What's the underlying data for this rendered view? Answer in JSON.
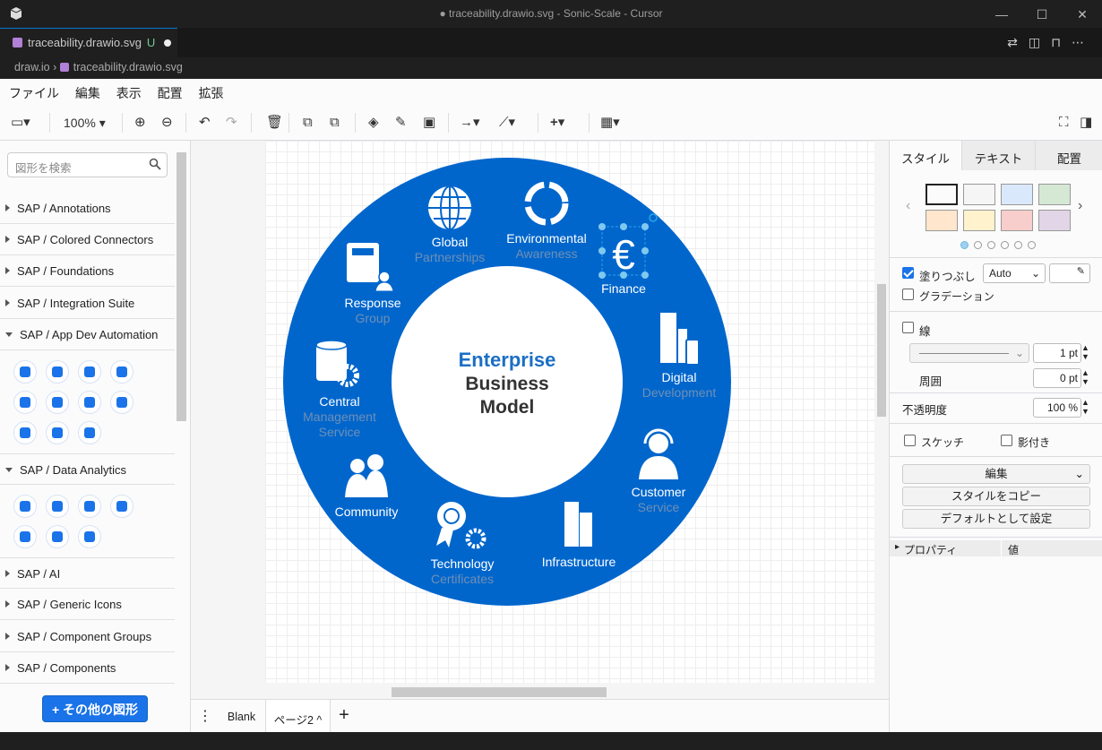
{
  "window": {
    "title": "● traceability.drawio.svg - Sonic-Scale - Cursor"
  },
  "editor_tab": {
    "filename": "traceability.drawio.svg",
    "modified": "U"
  },
  "breadcrumb": {
    "root": "draw.io",
    "file": "traceability.drawio.svg"
  },
  "menu": [
    "ファイル",
    "編集",
    "表示",
    "配置",
    "拡張"
  ],
  "toolbar": {
    "zoom": "100%"
  },
  "sidebar": {
    "search_placeholder": "図形を検索",
    "libraries": [
      "SAP / Annotations",
      "SAP / Colored Connectors",
      "SAP / Foundations",
      "SAP / Integration Suite",
      "SAP / App Dev Automation",
      "SAP / Data Analytics",
      "SAP / AI",
      "SAP / Generic Icons",
      "SAP / Component Groups",
      "SAP / Components"
    ],
    "more_shapes": "+ その他の図形"
  },
  "pages": {
    "page1": "Blank",
    "page2": "ページ2"
  },
  "diagram": {
    "center": {
      "line1": "Enterprise",
      "line2": "Business",
      "line3": "Model"
    },
    "segments": {
      "global": {
        "l1": "Global",
        "l2": "Partnerships"
      },
      "env": {
        "l1": "Environmental",
        "l2": "Awareness"
      },
      "finance": {
        "l1": "Finance"
      },
      "digital": {
        "l1": "Digital",
        "l2": "Development"
      },
      "customer": {
        "l1": "Customer",
        "l2": "Service"
      },
      "infra": {
        "l1": "Infrastructure"
      },
      "tech": {
        "l1": "Technology",
        "l2": "Certificates"
      },
      "community": {
        "l1": "Community"
      },
      "central": {
        "l1": "Central",
        "l2": "Management",
        "l3": "Service"
      },
      "response": {
        "l1": "Response",
        "l2": "Group"
      }
    },
    "colors": {
      "ring": "#0066cc",
      "center_blue": "#1a6fc4",
      "center_dark": "#333333",
      "sublabel": "#6f8fb5"
    }
  },
  "format_panel": {
    "tabs": [
      "スタイル",
      "テキスト",
      "配置"
    ],
    "swatches": [
      "#ffffff",
      "#f5f5f5",
      "#dae8fc",
      "#d5e8d4",
      "#ffe6cc",
      "#fff2cc",
      "#f8cecc",
      "#e1d5e7"
    ],
    "fill_label": "塗りつぶし",
    "fill_mode": "Auto",
    "gradient_label": "グラデーション",
    "line_label": "線",
    "line_width": "1 pt",
    "perimeter_label": "周囲",
    "perimeter": "0 pt",
    "opacity_label": "不透明度",
    "opacity": "100 %",
    "sketch_label": "スケッチ",
    "shadow_label": "影付き",
    "edit_select": "編集",
    "copy_style": "スタイルをコピー",
    "set_default": "デフォルトとして設定",
    "prop_col": "プロパティ",
    "value_col": "値"
  }
}
